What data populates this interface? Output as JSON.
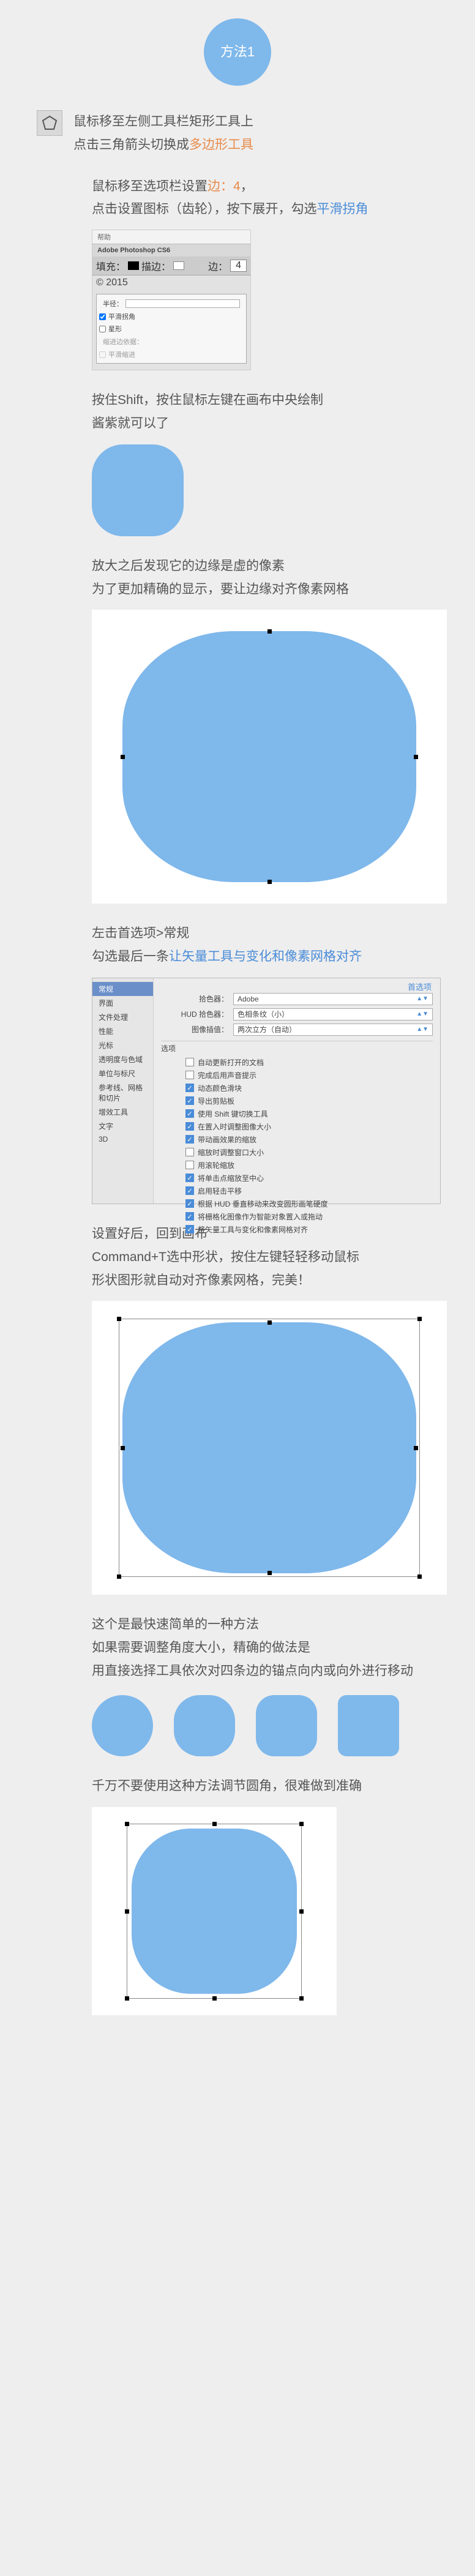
{
  "badge": {
    "label": "方法1"
  },
  "intro": {
    "line1_a": "鼠标移至左侧工具栏矩形工具上",
    "line2_a": "点击三角箭头切换成",
    "line2_hl": "多边形工具"
  },
  "step2": {
    "line1_a": "鼠标移至选项栏设置",
    "line1_hl": "边：4",
    "line1_b": "，",
    "line2_a": "点击设置图标（齿轮），按下展开，勾选",
    "line2_hl": "平滑拐角"
  },
  "ps_dialog": {
    "help": "帮助",
    "app": "Adobe Photoshop CS6",
    "fill": "填充：",
    "stroke": "描边：",
    "sides_label": "边：",
    "sides_value": "4",
    "year": "© 2015",
    "radius": "半径：",
    "opt_smooth": "平滑拐角",
    "opt_star": "星形",
    "indent": "缩进边依据：",
    "opt_smooth_indent": "平滑缩进"
  },
  "step3": {
    "line1": "按住Shift，按住鼠标左键在画布中央绘制",
    "line2": "酱紫就可以了"
  },
  "step4": {
    "line1": "放大之后发现它的边缘是虚的像素",
    "line2": "为了更加精确的显示，要让边缘对齐像素网格"
  },
  "step5": {
    "line1": "左击首选项>常规",
    "line2_a": "勾选最后一条",
    "line2_hl": "让矢量工具与变化和像素网格对齐"
  },
  "prefs": {
    "title": "首选项",
    "sidebar": [
      "常规",
      "界面",
      "文件处理",
      "性能",
      "光标",
      "透明度与色域",
      "单位与标尺",
      "参考线、网格和切片",
      "增效工具",
      "文字",
      "3D"
    ],
    "picker_label": "拾色器：",
    "picker_value": "Adobe",
    "hud_label": "HUD 拾色器：",
    "hud_value": "色相条纹（小）",
    "interp_label": "图像插值：",
    "interp_value": "两次立方（自动）",
    "options_title": "选项",
    "checks": [
      {
        "on": false,
        "label": "自动更新打开的文档"
      },
      {
        "on": false,
        "label": "完成后用声音提示"
      },
      {
        "on": true,
        "label": "动态颜色滑块"
      },
      {
        "on": true,
        "label": "导出剪贴板"
      },
      {
        "on": true,
        "label": "使用 Shift 键切换工具"
      },
      {
        "on": true,
        "label": "在置入时调整图像大小"
      },
      {
        "on": true,
        "label": "带动画效果的缩放"
      },
      {
        "on": false,
        "label": "缩放时调整窗口大小"
      },
      {
        "on": false,
        "label": "用滚轮缩放"
      },
      {
        "on": true,
        "label": "将单击点缩放至中心"
      },
      {
        "on": true,
        "label": "启用轻击平移"
      },
      {
        "on": true,
        "label": "根据 HUD 垂直移动来改变圆形画笔硬度"
      },
      {
        "on": true,
        "label": "将栅格化图像作为智能对象置入或拖动"
      },
      {
        "on": true,
        "label": "将矢量工具与变化和像素网格对齐"
      }
    ]
  },
  "step6": {
    "line1": "设置好后，回到画布",
    "line2": "Command+T选中形状，按住左键轻轻移动鼠标",
    "line3": "形状图形就自动对齐像素网格，完美！"
  },
  "step7": {
    "line1": "这个是最快速简单的一种方法",
    "line2": "如果需要调整角度大小，精确的做法是",
    "line3": "用直接选择工具依次对四条边的锚点向内或向外进行移动"
  },
  "step8": {
    "line1": "千万不要使用这种方法调节圆角，很难做到准确"
  }
}
